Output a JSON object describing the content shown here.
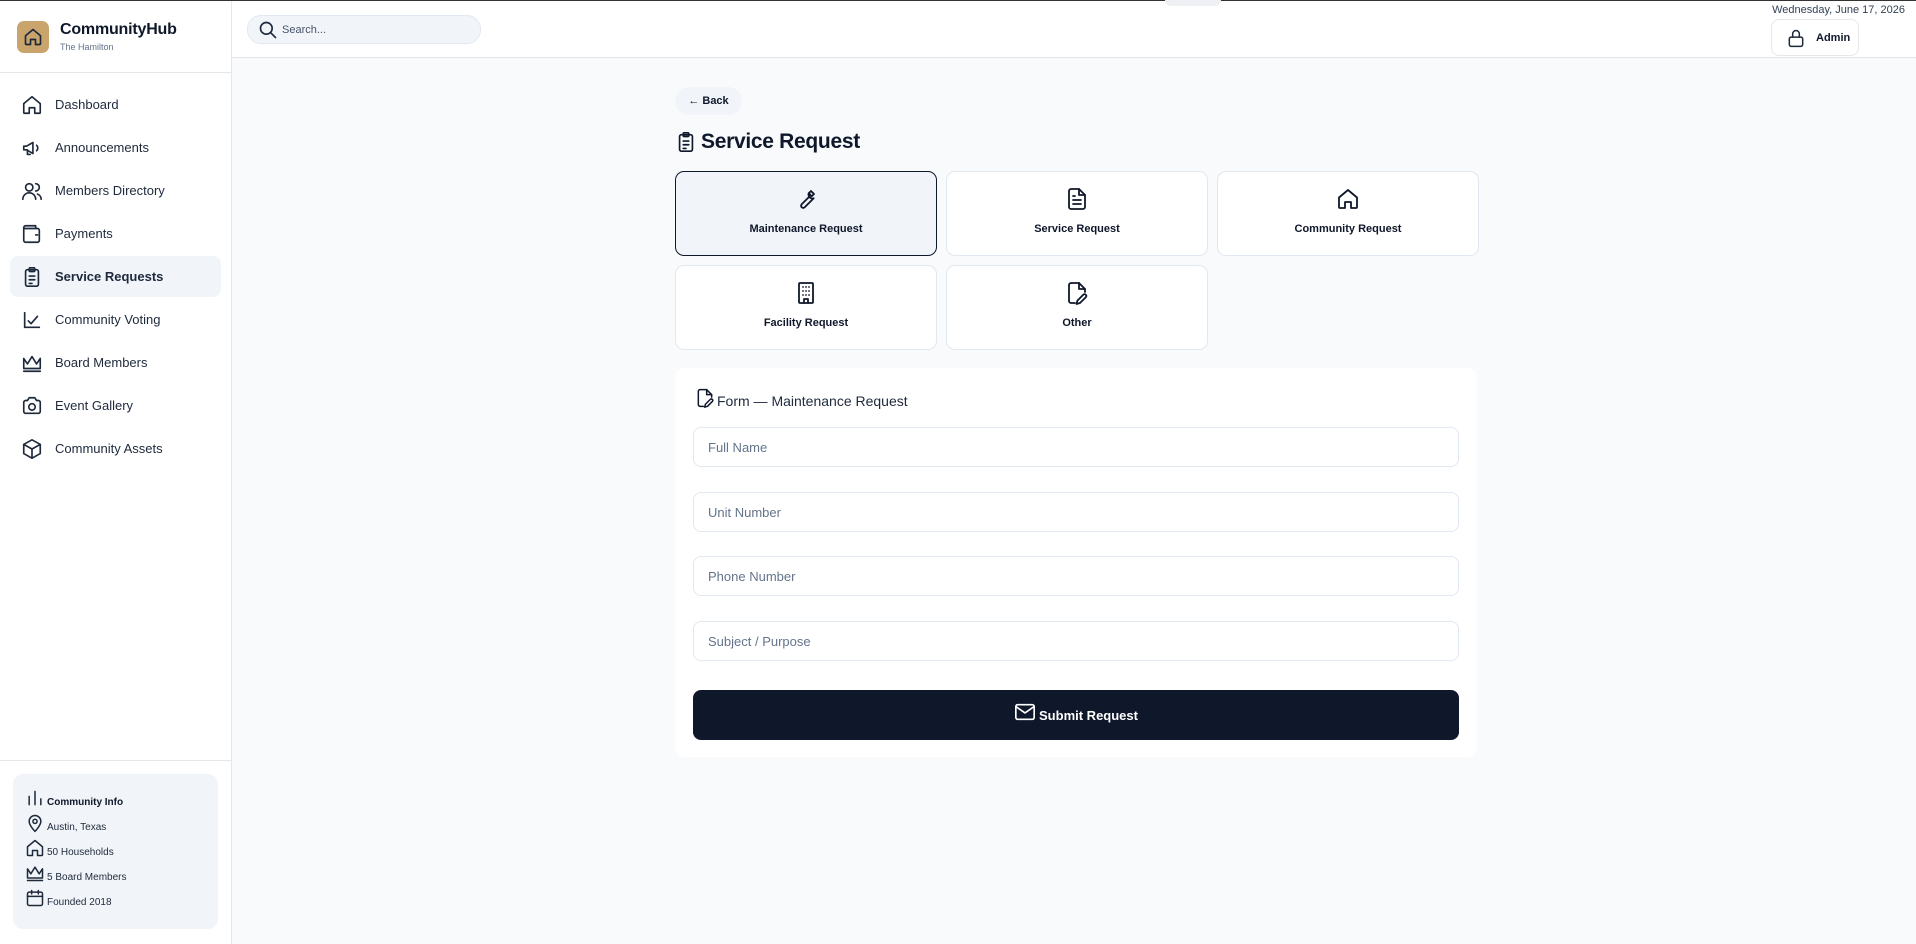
{
  "brand": {
    "name": "CommunityHub",
    "subtitle": "The Hamilton"
  },
  "sidebar": {
    "items": [
      {
        "label": "Dashboard",
        "icon": "home-icon"
      },
      {
        "label": "Announcements",
        "icon": "megaphone-icon"
      },
      {
        "label": "Members Directory",
        "icon": "users-icon"
      },
      {
        "label": "Payments",
        "icon": "wallet-icon"
      },
      {
        "label": "Service Requests",
        "icon": "clipboard-icon",
        "active": true
      },
      {
        "label": "Community Voting",
        "icon": "vote-icon"
      },
      {
        "label": "Board Members",
        "icon": "crown-icon"
      },
      {
        "label": "Event Gallery",
        "icon": "camera-icon"
      },
      {
        "label": "Community Assets",
        "icon": "box-icon"
      }
    ]
  },
  "community_info": {
    "title": "Community Info",
    "location": "Austin, Texas",
    "households": "50 Households",
    "board": "5 Board Members",
    "founded": "Founded 2018"
  },
  "header": {
    "search_placeholder": "Search...",
    "date": "Wednesday, June 17, 2026",
    "admin_label": "Admin"
  },
  "main": {
    "back_label": "← Back",
    "title": "Service Request",
    "categories": [
      {
        "label": "Maintenance Request",
        "icon": "wrench-icon",
        "selected": true
      },
      {
        "label": "Service Request",
        "icon": "document-icon"
      },
      {
        "label": "Community Request",
        "icon": "home-icon"
      },
      {
        "label": "Facility Request",
        "icon": "building-icon"
      },
      {
        "label": "Other",
        "icon": "file-edit-icon"
      }
    ],
    "form": {
      "title": "Form — Maintenance Request",
      "full_name_placeholder": "Full Name",
      "unit_placeholder": "Unit Number",
      "phone_placeholder": "Phone Number",
      "subject_placeholder": "Subject / Purpose",
      "submit_label": "Submit Request"
    }
  },
  "colors": {
    "primary": "#0f172a",
    "accent_logo": "#c9a46c",
    "surface": "#f1f5f9",
    "background": "#f8fafc"
  }
}
